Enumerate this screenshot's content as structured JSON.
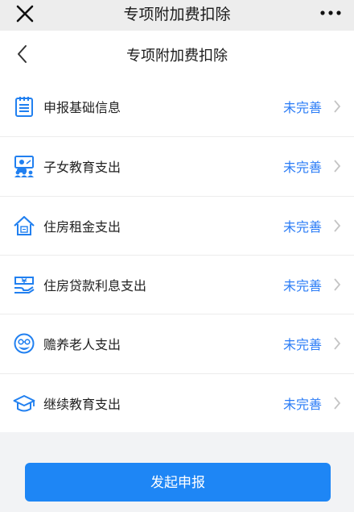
{
  "topbar": {
    "title": "专项附加费扣除"
  },
  "navbar": {
    "title": "专项附加费扣除"
  },
  "items": [
    {
      "label": "申报基础信息",
      "status": "未完善",
      "icon": "document-list-icon"
    },
    {
      "label": "子女教育支出",
      "status": "未完善",
      "icon": "teacher-board-icon"
    },
    {
      "label": "住房租金支出",
      "status": "未完善",
      "icon": "house-rent-icon"
    },
    {
      "label": "住房贷款利息支出",
      "status": "未完善",
      "icon": "yuan-payment-icon"
    },
    {
      "label": "赡养老人支出",
      "status": "未完善",
      "icon": "elder-face-icon"
    },
    {
      "label": "继续教育支出",
      "status": "未完善",
      "icon": "graduation-cap-icon"
    }
  ],
  "submit_label": "发起申报",
  "colors": {
    "accent": "#1e86f5",
    "status": "#2b7cf6",
    "icon": "#2180f0"
  }
}
